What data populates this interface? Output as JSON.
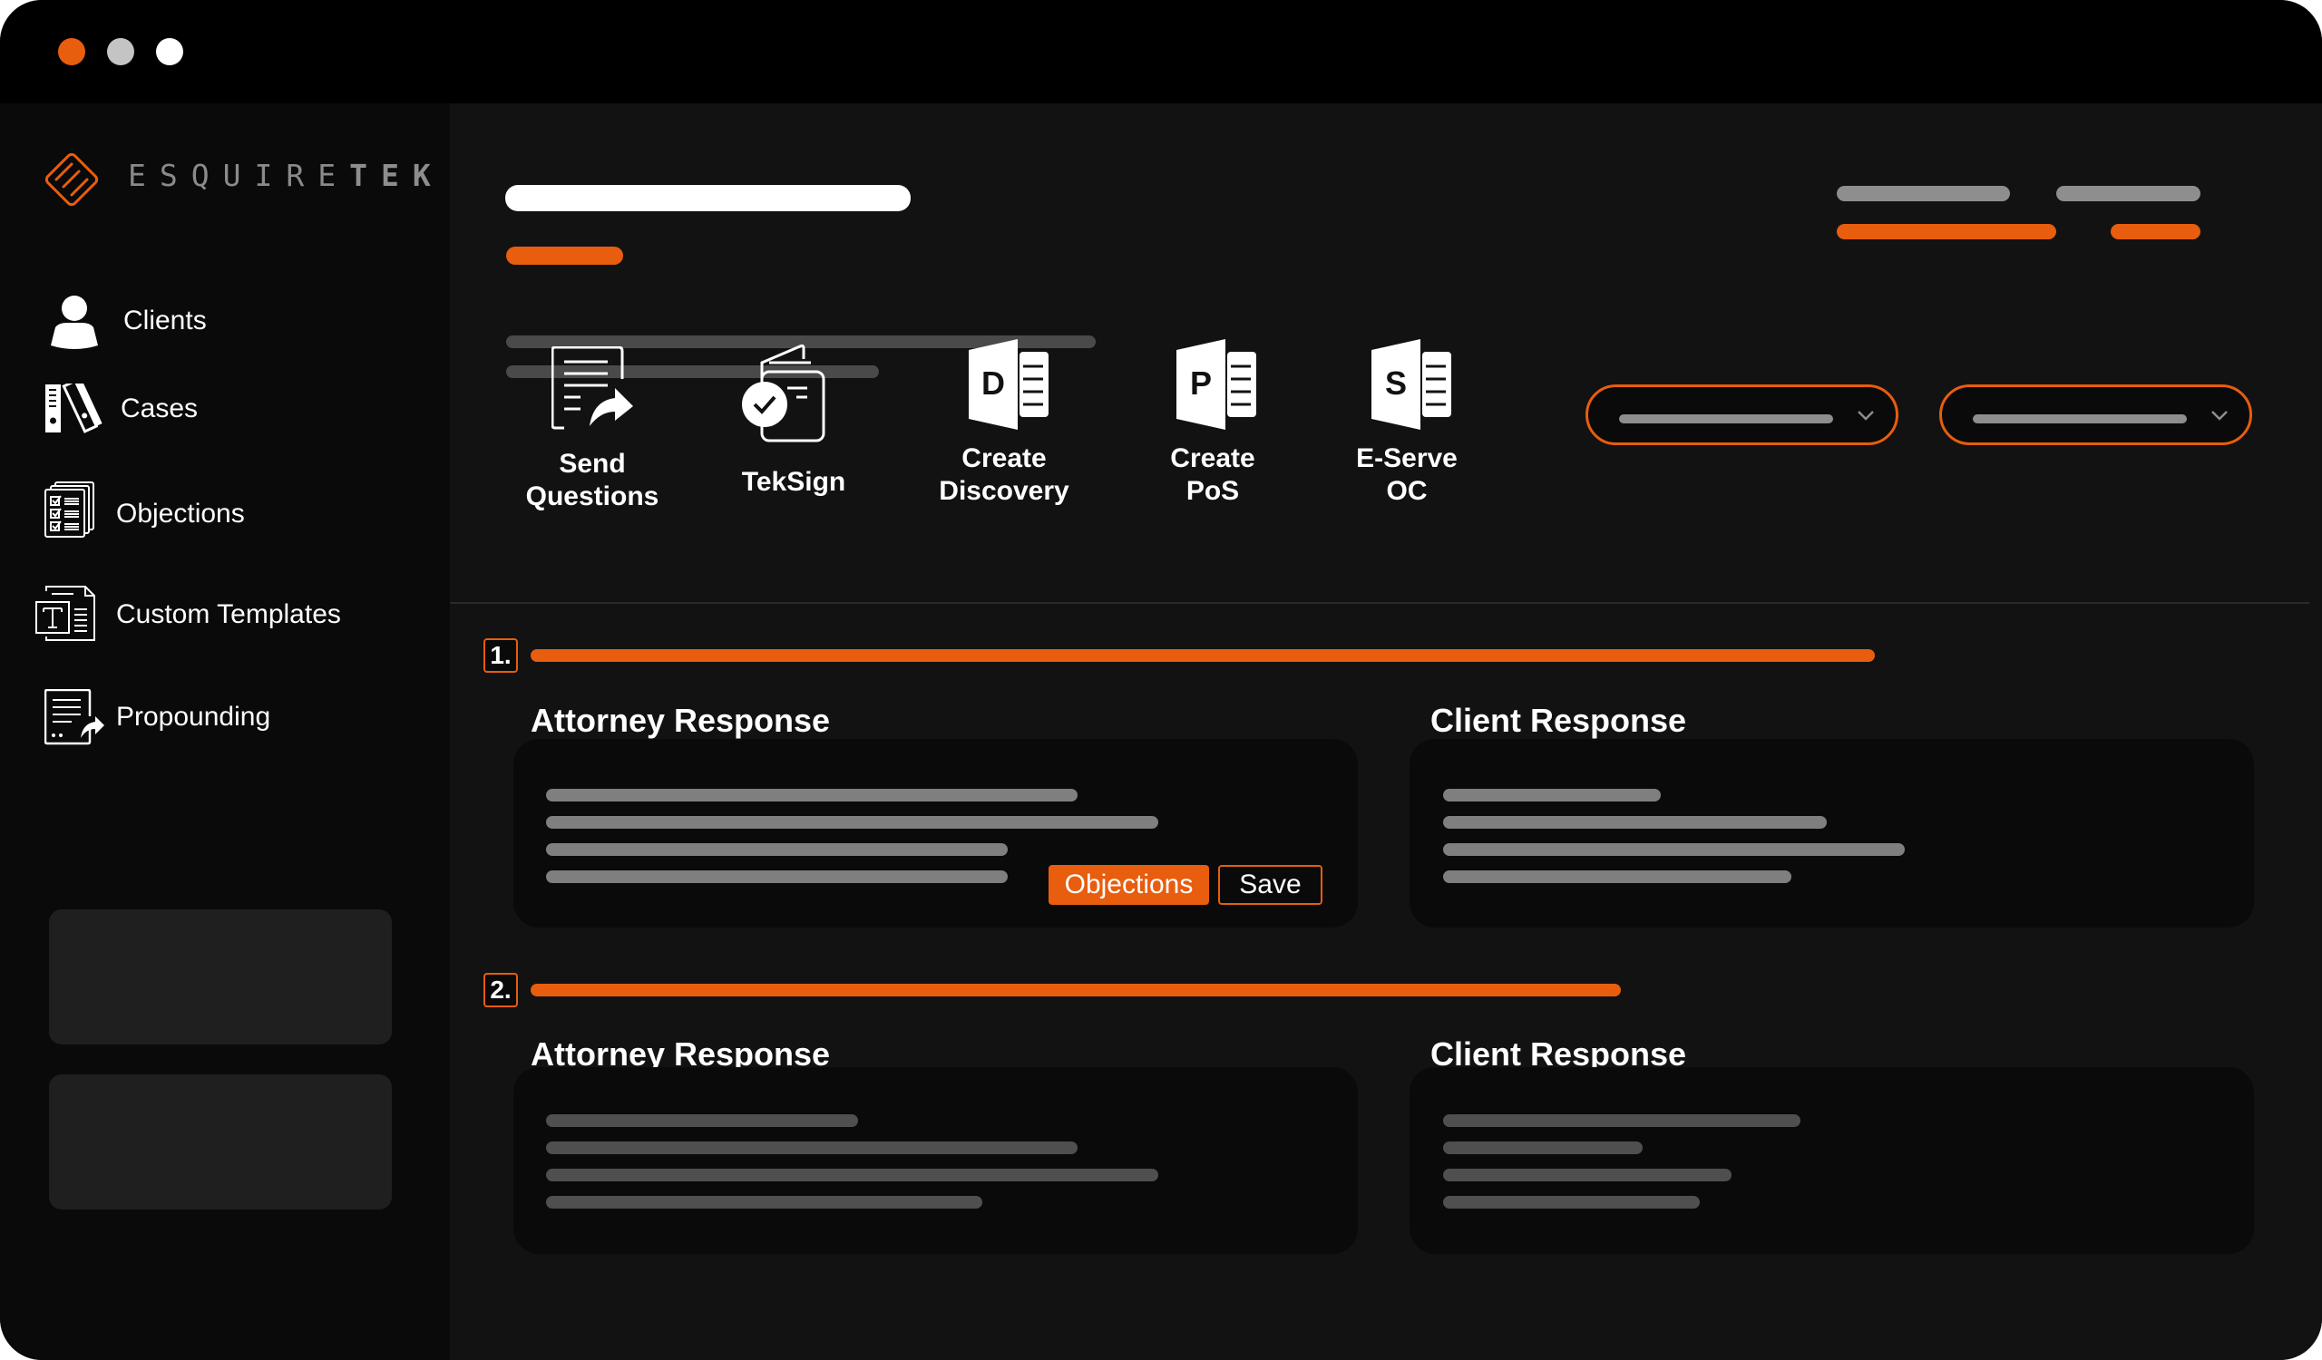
{
  "window": {
    "controls": [
      {
        "name": "close",
        "color": "#E85D0E"
      },
      {
        "name": "minimize",
        "color": "#C4C4C4"
      },
      {
        "name": "maximize",
        "color": "#FFFFFF"
      }
    ]
  },
  "brand": {
    "name_light": "ESQUIRE",
    "name_bold": "TEK",
    "accent_color": "#E85D0E"
  },
  "sidebar": {
    "items": [
      {
        "label": "Clients",
        "icon": "user-icon"
      },
      {
        "label": "Cases",
        "icon": "binders-icon"
      },
      {
        "label": "Objections",
        "icon": "checklist-stack-icon"
      },
      {
        "label": "Custom Templates",
        "icon": "text-template-icon"
      },
      {
        "label": "Propounding",
        "icon": "document-forward-icon"
      }
    ]
  },
  "actions": [
    {
      "label_line1": "Send",
      "label_line2": "Questions",
      "icon": "document-share-icon"
    },
    {
      "label_line1": "TekSign",
      "label_line2": "",
      "icon": "signed-document-icon"
    },
    {
      "label_line1": "Create",
      "label_line2": "Discovery",
      "icon": "doc-d-icon",
      "glyph": "D"
    },
    {
      "label_line1": "Create",
      "label_line2": "PoS",
      "icon": "doc-p-icon",
      "glyph": "P"
    },
    {
      "label_line1": "E-Serve",
      "label_line2": "OC",
      "icon": "doc-s-icon",
      "glyph": "S"
    }
  ],
  "questions": [
    {
      "number": "1.",
      "attorney": {
        "title": "Attorney Response",
        "objections_label": "Objections",
        "save_label": "Save"
      },
      "client": {
        "title": "Client Response"
      }
    },
    {
      "number": "2.",
      "attorney": {
        "title": "Attorney Response"
      },
      "client": {
        "title": "Client Response"
      }
    }
  ]
}
